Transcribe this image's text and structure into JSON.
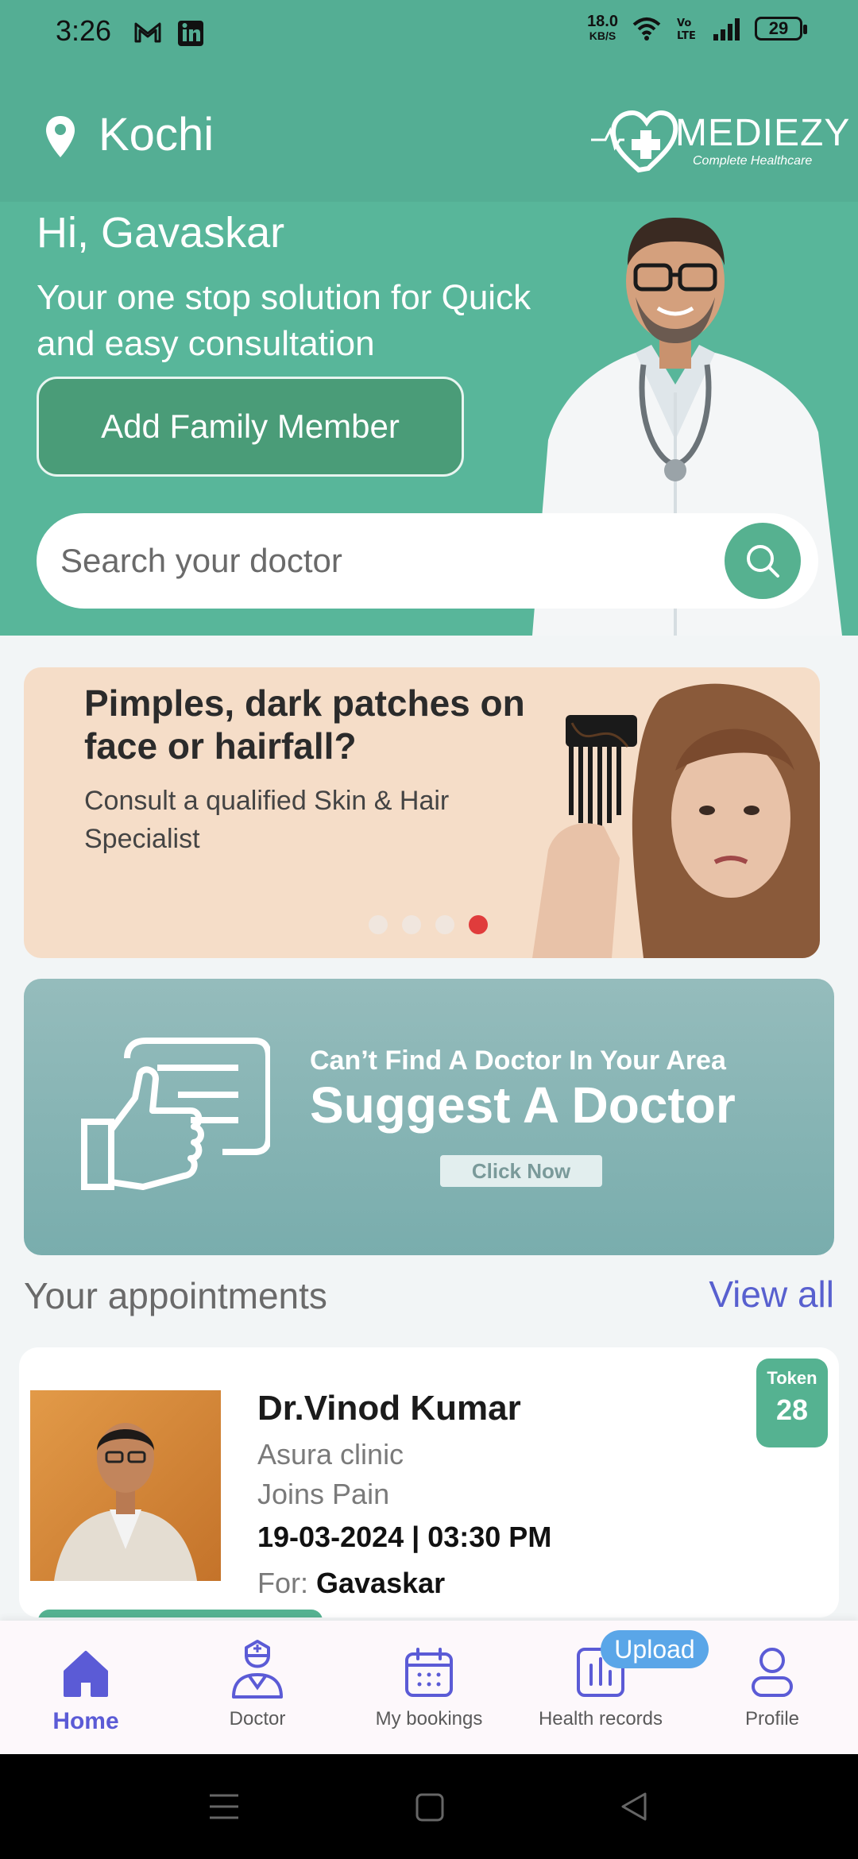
{
  "status_bar": {
    "time": "3:26",
    "net_speed_value": "18.0",
    "net_speed_unit": "KB/S",
    "battery": "29"
  },
  "header": {
    "location": "Kochi",
    "brand_name": "MEDIEZY",
    "brand_tagline": "Complete Healthcare"
  },
  "hero": {
    "greeting": "Hi, Gavaskar",
    "tagline": "Your one stop solution for Quick and easy consultation",
    "add_family_label": "Add Family Member",
    "search_placeholder": "Search your doctor"
  },
  "promo": {
    "title": "Pimples, dark patches on face or hairfall?",
    "subtitle": "Consult a qualified Skin & Hair Specialist",
    "dots_count": 4,
    "active_dot": 4
  },
  "suggest": {
    "small_text": "Can’t Find A Doctor In Your Area",
    "big_text": "Suggest A Doctor",
    "button_label": "Click Now"
  },
  "appointments": {
    "section_title": "Your appointments",
    "view_all_label": "View all",
    "items": [
      {
        "doctor": "Dr.Vinod Kumar",
        "clinic": "Asura clinic",
        "complaint": "Joins Pain",
        "datetime": "19-03-2024 | 03:30 PM",
        "for_label": "For: ",
        "for_name": "Gavaskar",
        "token_label": "Token",
        "token_number": "28"
      }
    ]
  },
  "bottom_nav": {
    "items": [
      {
        "label": "Home",
        "icon": "home-icon",
        "active": true
      },
      {
        "label": "Doctor",
        "icon": "doctor-icon",
        "active": false
      },
      {
        "label": "My bookings",
        "icon": "calendar-icon",
        "active": false
      },
      {
        "label": "Health records",
        "icon": "chart-icon",
        "active": false
      },
      {
        "label": "Profile",
        "icon": "profile-icon",
        "active": false
      }
    ],
    "upload_badge": "Upload"
  },
  "colors": {
    "primary_green": "#54ae94",
    "accent_blue": "#5b5bd6",
    "promo_bg": "#f5ddc8",
    "suggest_bg": "#79adad"
  }
}
